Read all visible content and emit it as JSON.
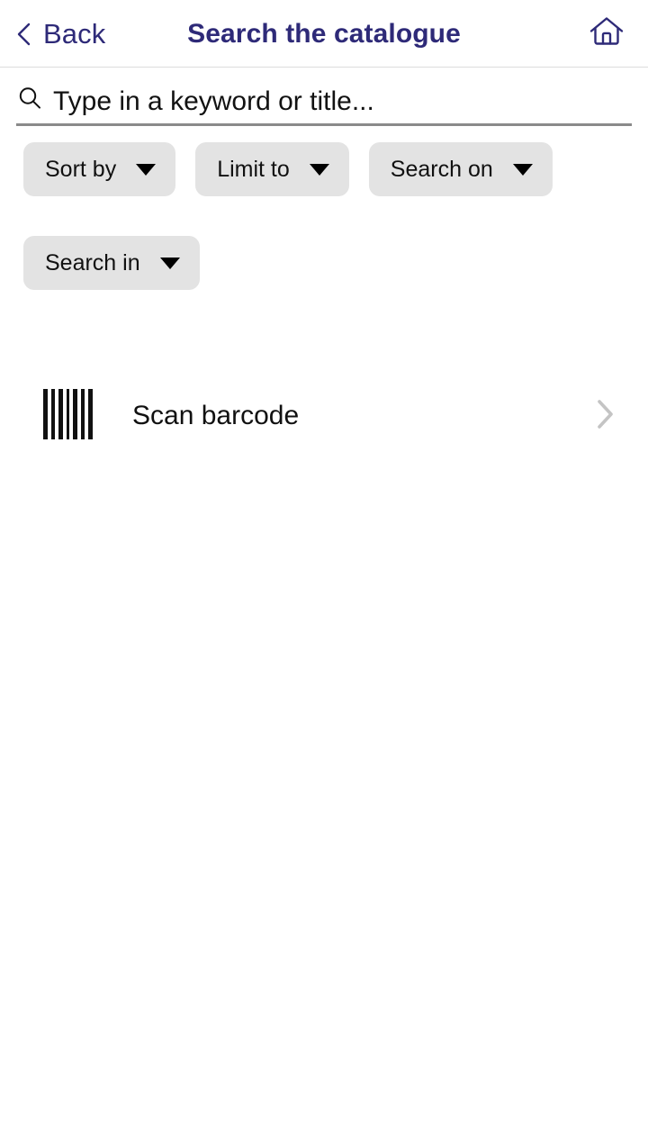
{
  "theme": {
    "brand_navy": "#2e2a78",
    "chip_background": "#e3e3e3",
    "text_primary": "#111111",
    "chevron_gray": "#c4c4c4",
    "divider_gray": "#dcdcdc",
    "underline_gray": "#8a8a8a",
    "page_background": "#ffffff"
  },
  "header": {
    "back_label": "Back",
    "back_icon": "chevron-left-icon",
    "title": "Search the catalogue",
    "home_icon": "home-icon"
  },
  "search": {
    "icon": "search-icon",
    "placeholder": "Type in a keyword or title...",
    "value": ""
  },
  "filters": {
    "chips": [
      {
        "label": "Sort by",
        "icon": "caret-down-icon"
      },
      {
        "label": "Limit to",
        "icon": "caret-down-icon"
      },
      {
        "label": "Search on",
        "icon": "caret-down-icon"
      },
      {
        "label": "Search in",
        "icon": "caret-down-icon"
      }
    ]
  },
  "actions": {
    "scan_barcode": {
      "label": "Scan barcode",
      "leading_icon": "barcode-icon",
      "trailing_icon": "chevron-right-icon"
    }
  }
}
